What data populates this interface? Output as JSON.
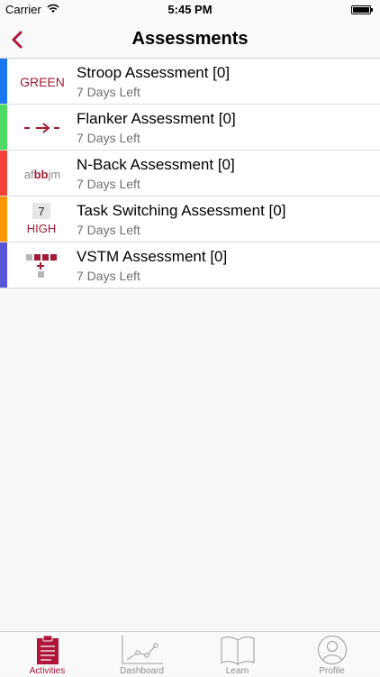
{
  "status_bar": {
    "carrier": "Carrier",
    "time": "5:45 PM"
  },
  "nav": {
    "title": "Assessments"
  },
  "colors": {
    "accent": "#b0153a",
    "icon_red": "#a01a33"
  },
  "assessments": [
    {
      "title": "Stroop Assessment [0]",
      "subtitle": "7 Days Left",
      "color": "#1a76f2",
      "icon": "stroop-icon",
      "icon_text": "GREEN"
    },
    {
      "title": "Flanker Assessment [0]",
      "subtitle": "7 Days Left",
      "color": "#4cd964",
      "icon": "flanker-icon"
    },
    {
      "title": "N-Back Assessment [0]",
      "subtitle": "7 Days Left",
      "color": "#f24236",
      "icon": "nback-icon",
      "icon_text": [
        "af",
        "bb",
        "jm"
      ]
    },
    {
      "title": "Task Switching Assessment [0]",
      "subtitle": "7 Days Left",
      "color": "#ff9500",
      "icon": "task-switching-icon",
      "icon_text": [
        "7",
        "HIGH"
      ]
    },
    {
      "title": "VSTM Assessment [0]",
      "subtitle": "7 Days Left",
      "color": "#5856d6",
      "icon": "vstm-icon"
    }
  ],
  "tabs": [
    {
      "label": "Activities",
      "icon": "clipboard-icon",
      "active": true
    },
    {
      "label": "Dashboard",
      "icon": "chart-icon",
      "active": false
    },
    {
      "label": "Learn",
      "icon": "book-icon",
      "active": false
    },
    {
      "label": "Profile",
      "icon": "person-icon",
      "active": false
    }
  ]
}
